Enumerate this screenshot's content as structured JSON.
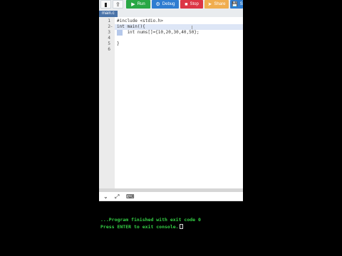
{
  "toolbar": {
    "run_label": "Run",
    "debug_label": "Debug",
    "stop_label": "Stop",
    "share_label": "Share",
    "save_label": "S",
    "icons": {
      "new": "file-icon",
      "upload": "upload-icon",
      "run": "play-icon",
      "debug": "gear-icon",
      "stop": "stop-icon",
      "share": "share-icon",
      "save": "save-icon"
    },
    "colors": {
      "run": "#28a745",
      "debug": "#2f7dd1",
      "stop": "#dc3545",
      "share": "#f0ad4e",
      "save": "#2f7dd1"
    }
  },
  "file_tab": {
    "label": "main.c"
  },
  "editor": {
    "lines": [
      {
        "num": "1",
        "text": "#include <stdio.h>"
      },
      {
        "num": "2",
        "text": "int main(){"
      },
      {
        "num": "3",
        "text": "    int nums[]={10,20,30,40,50};"
      },
      {
        "num": "4",
        "text": ""
      },
      {
        "num": "5",
        "text": "}"
      },
      {
        "num": "6",
        "text": ""
      }
    ],
    "fold_marker": "−"
  },
  "console_bar": {
    "icons": [
      "chevron-down-icon",
      "expand-icon",
      "input-icon"
    ]
  },
  "console": {
    "lines": [
      "...Program finished with exit code 0",
      "Press ENTER to exit console."
    ]
  }
}
